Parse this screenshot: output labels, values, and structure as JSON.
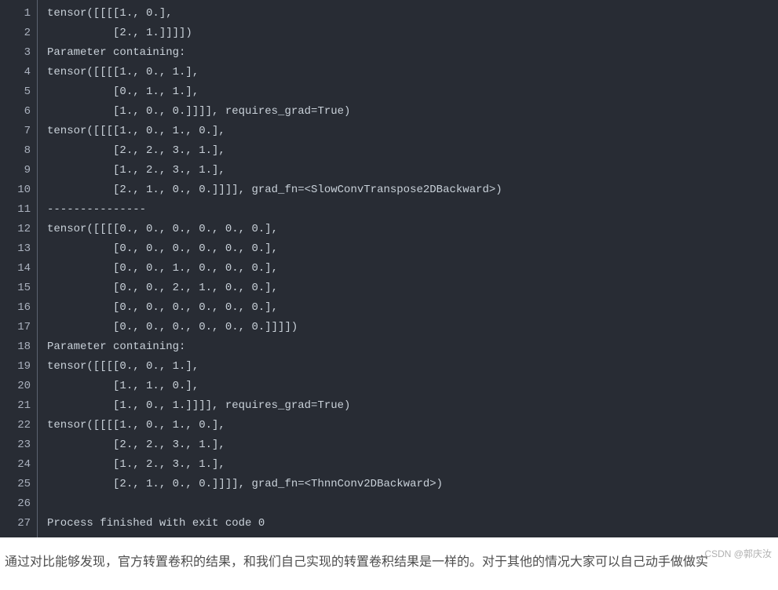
{
  "code": {
    "lines": [
      "tensor([[[[1., 0.],",
      "          [2., 1.]]]])",
      "Parameter containing:",
      "tensor([[[[1., 0., 1.],",
      "          [0., 1., 1.],",
      "          [1., 0., 0.]]]], requires_grad=True)",
      "tensor([[[[1., 0., 1., 0.],",
      "          [2., 2., 3., 1.],",
      "          [1., 2., 3., 1.],",
      "          [2., 1., 0., 0.]]]], grad_fn=<SlowConvTranspose2DBackward>)",
      "---------------",
      "tensor([[[[0., 0., 0., 0., 0., 0.],",
      "          [0., 0., 0., 0., 0., 0.],",
      "          [0., 0., 1., 0., 0., 0.],",
      "          [0., 0., 2., 1., 0., 0.],",
      "          [0., 0., 0., 0., 0., 0.],",
      "          [0., 0., 0., 0., 0., 0.]]]])",
      "Parameter containing:",
      "tensor([[[[0., 0., 1.],",
      "          [1., 1., 0.],",
      "          [1., 0., 1.]]]], requires_grad=True)",
      "tensor([[[[1., 0., 1., 0.],",
      "          [2., 2., 3., 1.],",
      "          [1., 2., 3., 1.],",
      "          [2., 1., 0., 0.]]]], grad_fn=<ThnnConv2DBackward>)",
      "",
      "Process finished with exit code 0"
    ]
  },
  "paragraph": "通过对比能够发现，官方转置卷积的结果，和我们自己实现的转置卷积结果是一样的。对于其他的情况大家可以自己动手做做实",
  "watermark": "CSDN @郭庆汝"
}
